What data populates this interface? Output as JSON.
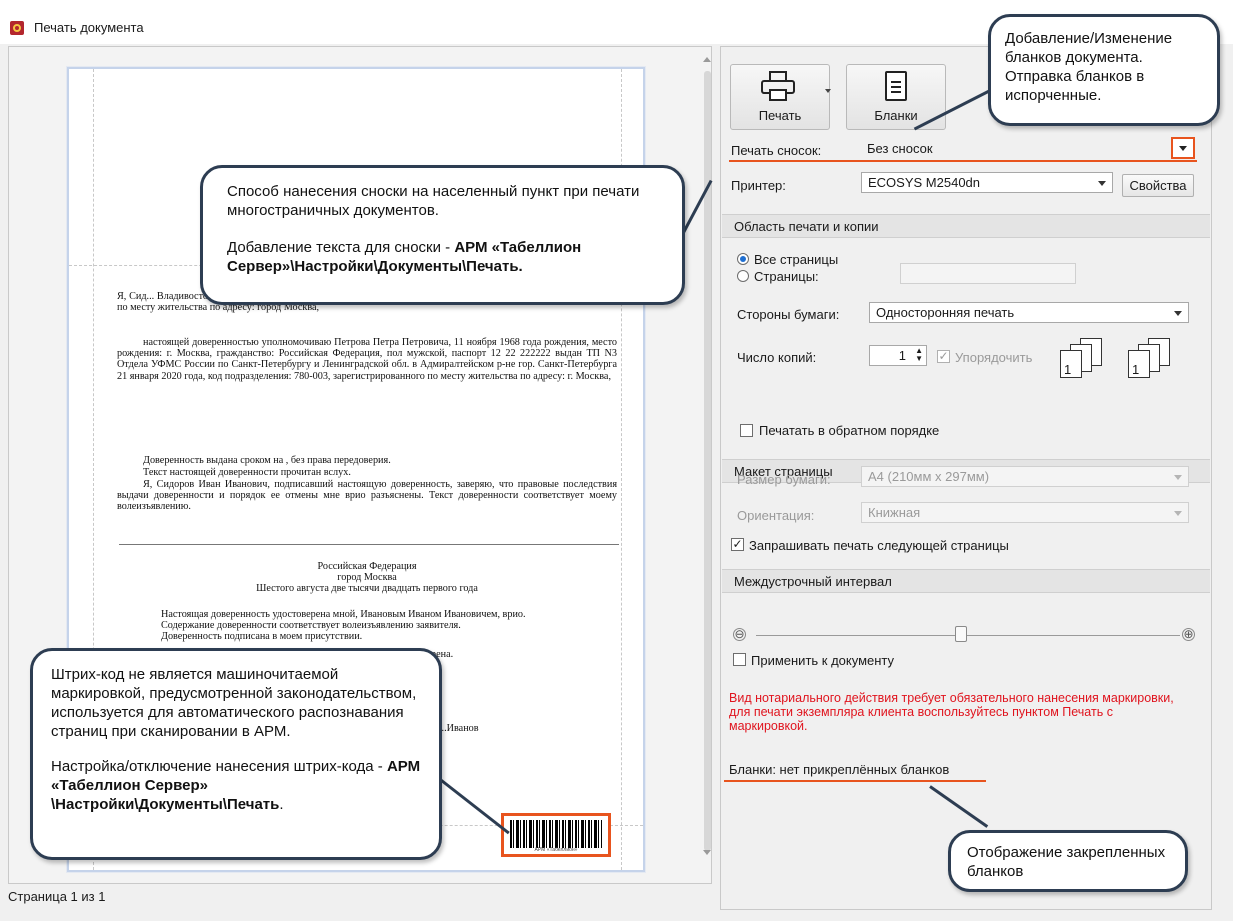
{
  "window": {
    "title": "Печать документа"
  },
  "toolbar": {
    "print_label": "Печать",
    "blanks_label": "Бланки"
  },
  "footnotes": {
    "label": "Печать сносок:",
    "value": "Без сносок"
  },
  "printer": {
    "label": "Принтер:",
    "value": "ECOSYS M2540dn",
    "properties_label": "Свойства"
  },
  "print_area": {
    "header": "Область печати и копии",
    "all_pages": "Все страницы",
    "pages": "Страницы:",
    "pages_value": "",
    "sides_label": "Стороны бумаги:",
    "sides_value": "Односторонняя печать",
    "copies_label": "Число копий:",
    "copies_value": "1",
    "collate_label": "Упорядочить",
    "reverse_label": "Печатать в обратном порядке"
  },
  "layout": {
    "header": "Макет страницы",
    "paper_label": "Размер бумаги:",
    "paper_value": "A4 (210мм x 297мм)",
    "orientation_label": "Ориентация:",
    "orientation_value": "Книжная",
    "ask_next_label": "Запрашивать печать следующей страницы"
  },
  "spacing": {
    "header": "Междустрочный интервал",
    "apply_label": "Применить к документу",
    "minus": "⊖",
    "plus": "⊕",
    "level": 0.47
  },
  "warning": "Вид нотариального действия требует обязательного нанесения маркировки, для печати экземпляра клиента воспользуйтесь пунктом Печать с маркировкой.",
  "blanks_status": "Бланки: нет прикреплённых бланков",
  "status": {
    "page_info": "Страница 1 из 1"
  },
  "document": {
    "para1": "Я, Сид... Владивосток, граж... УФМС г.Москва 22 сентября 2019 года, код подразделения: 34, зарегистрированный по месту жительства по адресу: город Москва,",
    "para2": "настоящей доверенностью уполномочиваю Петрова Петра Петровича, 11 ноября 1968 года рождения, место рождения: г. Москва, гражданство: Российская Федерация, пол мужской, паспорт 12 22 222222 выдан ТП N3 Отдела УФМС России по Санкт-Петербургу и Ленинградской обл. в Адмиралтейском р-не гор. Санкт-Петербурга 21 января 2020 года, код подразделения: 780-003, зарегистрированного по месту жительства по адресу: г. Москва,",
    "para3": "Доверенность выдана сроком на , без права передоверия.",
    "para4": "Текст настоящей доверенности прочитан вслух.",
    "para5": "Я, Сидоров Иван Иванович, подписавший настоящую доверенность, заверяю, что правовые последствия выдачи доверенности и порядок ее отмены мне врио разъяснены. Текст доверенности соответствует моему волеизъявлению.",
    "cert1": "Российская Федерация",
    "cert2": "город Москва",
    "cert3": "Шестого августа две тысячи двадцать первого года",
    "cert4": "Настоящая доверенность удостоверена мной, Ивановым Иваном Ивановичем, врио.",
    "cert5": "Содержание доверенности соответствует волеизъявлению заявителя.",
    "cert6": "Доверенность подписана в моем присутствии.",
    "cert7": "...оверена.",
    "cert8": "...Иванов",
    "barcode_caption": "АРМ «Табеллион»"
  },
  "callouts": {
    "blanks": "Добавление/Изменение бланков документа. Отправка бланков в испорченные.",
    "footnote_line1": "Способ нанесения сноски на населенный пункт при печати многостраничных документов.",
    "footnote_line2": "Добавление текста для сноски - ",
    "footnote_bold": "АРМ «Табеллион Сервер»\\Настройки\\Документы\\Печать.",
    "barcode_line1": "Штрих-код не является машиночитаемой маркировкой, предусмотренной законодательством, используется для автоматического распознавания страниц при сканировании в АРМ.",
    "barcode_line2": "Настройка/отключение нанесения штрих-кода - ",
    "barcode_bold": "АРМ «Табеллион Сервер» \\Настройки\\Документы\\Печать",
    "barcode_tail": ".",
    "attached": "Отображение закрепленных бланков"
  }
}
